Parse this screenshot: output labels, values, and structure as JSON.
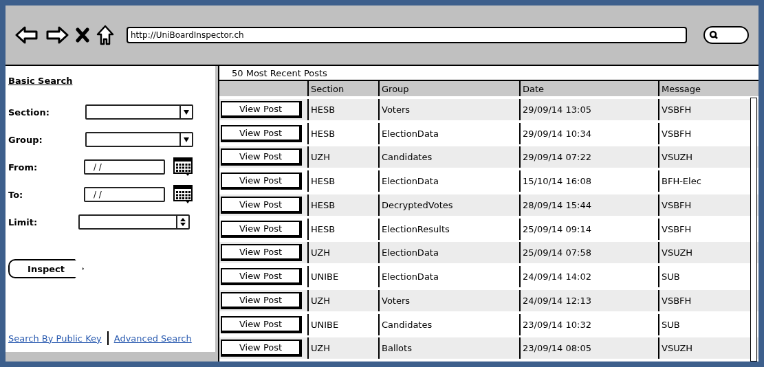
{
  "browser": {
    "address": "http://UniBoardInspector.ch"
  },
  "search_panel": {
    "title": "Basic Search",
    "fields": [
      {
        "label": "Section:",
        "kind": "dropdown"
      },
      {
        "label": "Group:",
        "kind": "dropdown"
      },
      {
        "label": "From:",
        "kind": "date",
        "value": "/ /"
      },
      {
        "label": "To:",
        "kind": "date",
        "value": "/ /"
      },
      {
        "label": "Limit:",
        "kind": "spinner"
      }
    ],
    "button": "Inspect",
    "links": [
      "Search By Public Key",
      "Advanced Search"
    ]
  },
  "posts": {
    "title": "50 Most Recent Posts",
    "columns": [
      "Section",
      "Group",
      "Date",
      "Message"
    ],
    "rows": [
      {
        "button": "View Post",
        "cells": [
          "HESB",
          "Voters",
          "29/09/14 13:05",
          "VSBFH"
        ]
      },
      {
        "button": "View Post",
        "cells": [
          "HESB",
          "ElectionData",
          "29/09/14 10:34",
          "VSBFH"
        ]
      },
      {
        "button": "View Post",
        "cells": [
          "UZH",
          "Candidates",
          "29/09/14 07:22",
          "VSUZH"
        ]
      },
      {
        "button": "View Post",
        "cells": [
          "HESB",
          "ElectionData",
          "15/10/14 16:08",
          "BFH-Elec"
        ]
      },
      {
        "button": "View Post",
        "cells": [
          "HESB",
          "DecryptedVotes",
          "28/09/14 15:44",
          "VSBFH"
        ]
      },
      {
        "button": "View Post",
        "cells": [
          "HESB",
          "ElectionResults",
          "25/09/14 09:14",
          "VSBFH"
        ]
      },
      {
        "button": "View Post",
        "cells": [
          "UZH",
          "ElectionData",
          "25/09/14 07:58",
          "VSUZH"
        ]
      },
      {
        "button": "View Post",
        "cells": [
          "UNIBE",
          "ElectionData",
          "24/09/14 14:02",
          "SUB"
        ]
      },
      {
        "button": "View Post",
        "cells": [
          "UZH",
          "Voters",
          "24/09/14 12:13",
          "VSBFH"
        ]
      },
      {
        "button": "View Post",
        "cells": [
          "UNIBE",
          "Candidates",
          "23/09/14 10:32",
          "SUB"
        ]
      },
      {
        "button": "View Post",
        "cells": [
          "UZH",
          "Ballots",
          "23/09/14 08:05",
          "VSUZH"
        ]
      }
    ]
  }
}
